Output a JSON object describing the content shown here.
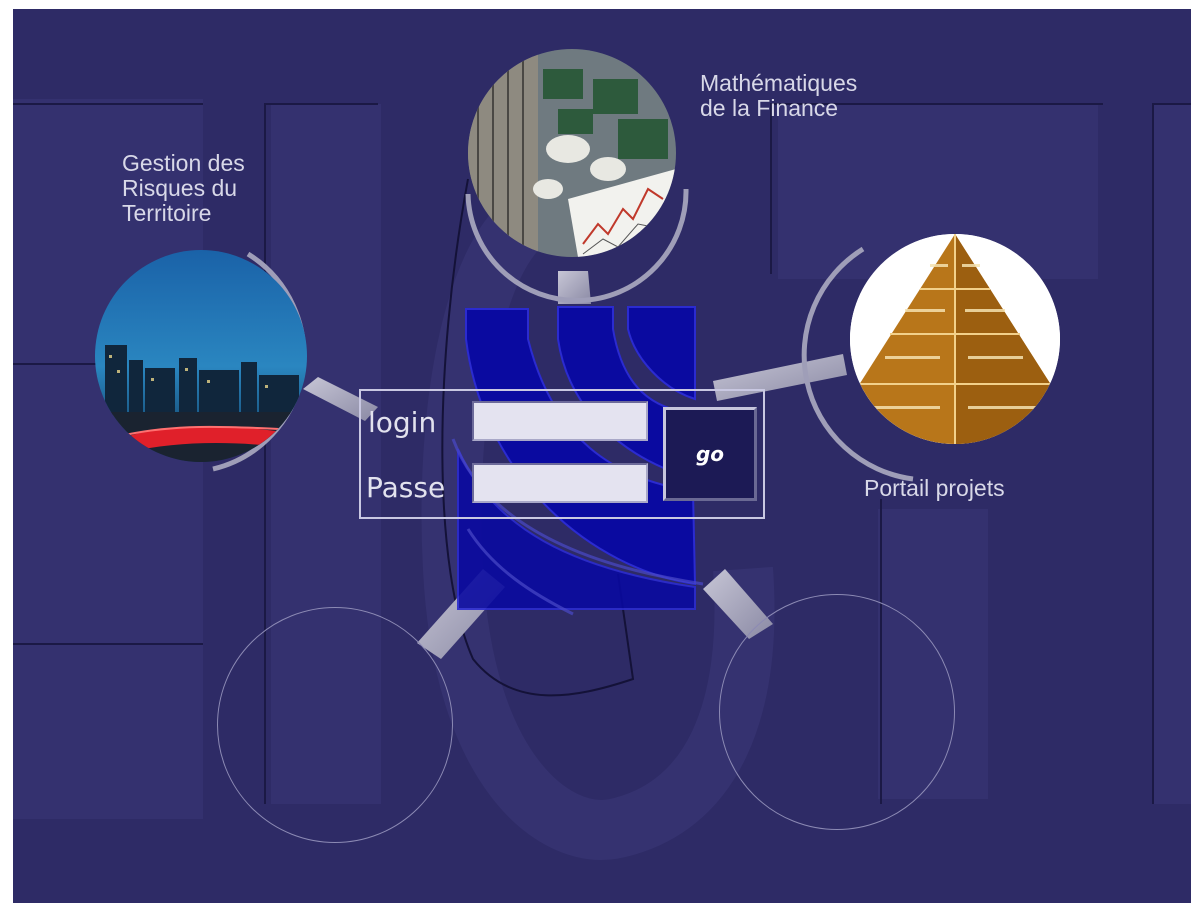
{
  "links": {
    "gestion": {
      "lines": [
        "Gestion des",
        "Risques du",
        "Territoire"
      ]
    },
    "finance": {
      "lines": [
        "Mathématiques",
        "de la Finance"
      ]
    },
    "portail": {
      "label": "Portail projets"
    }
  },
  "login_form": {
    "login_label": "login",
    "passe_label": "Passe",
    "login_value": "",
    "passe_value": "",
    "go_label": "go"
  },
  "colors": {
    "background": "#2e2b66",
    "logo_blue": "#0a0a9c",
    "label_text": "#d8d8e8"
  }
}
